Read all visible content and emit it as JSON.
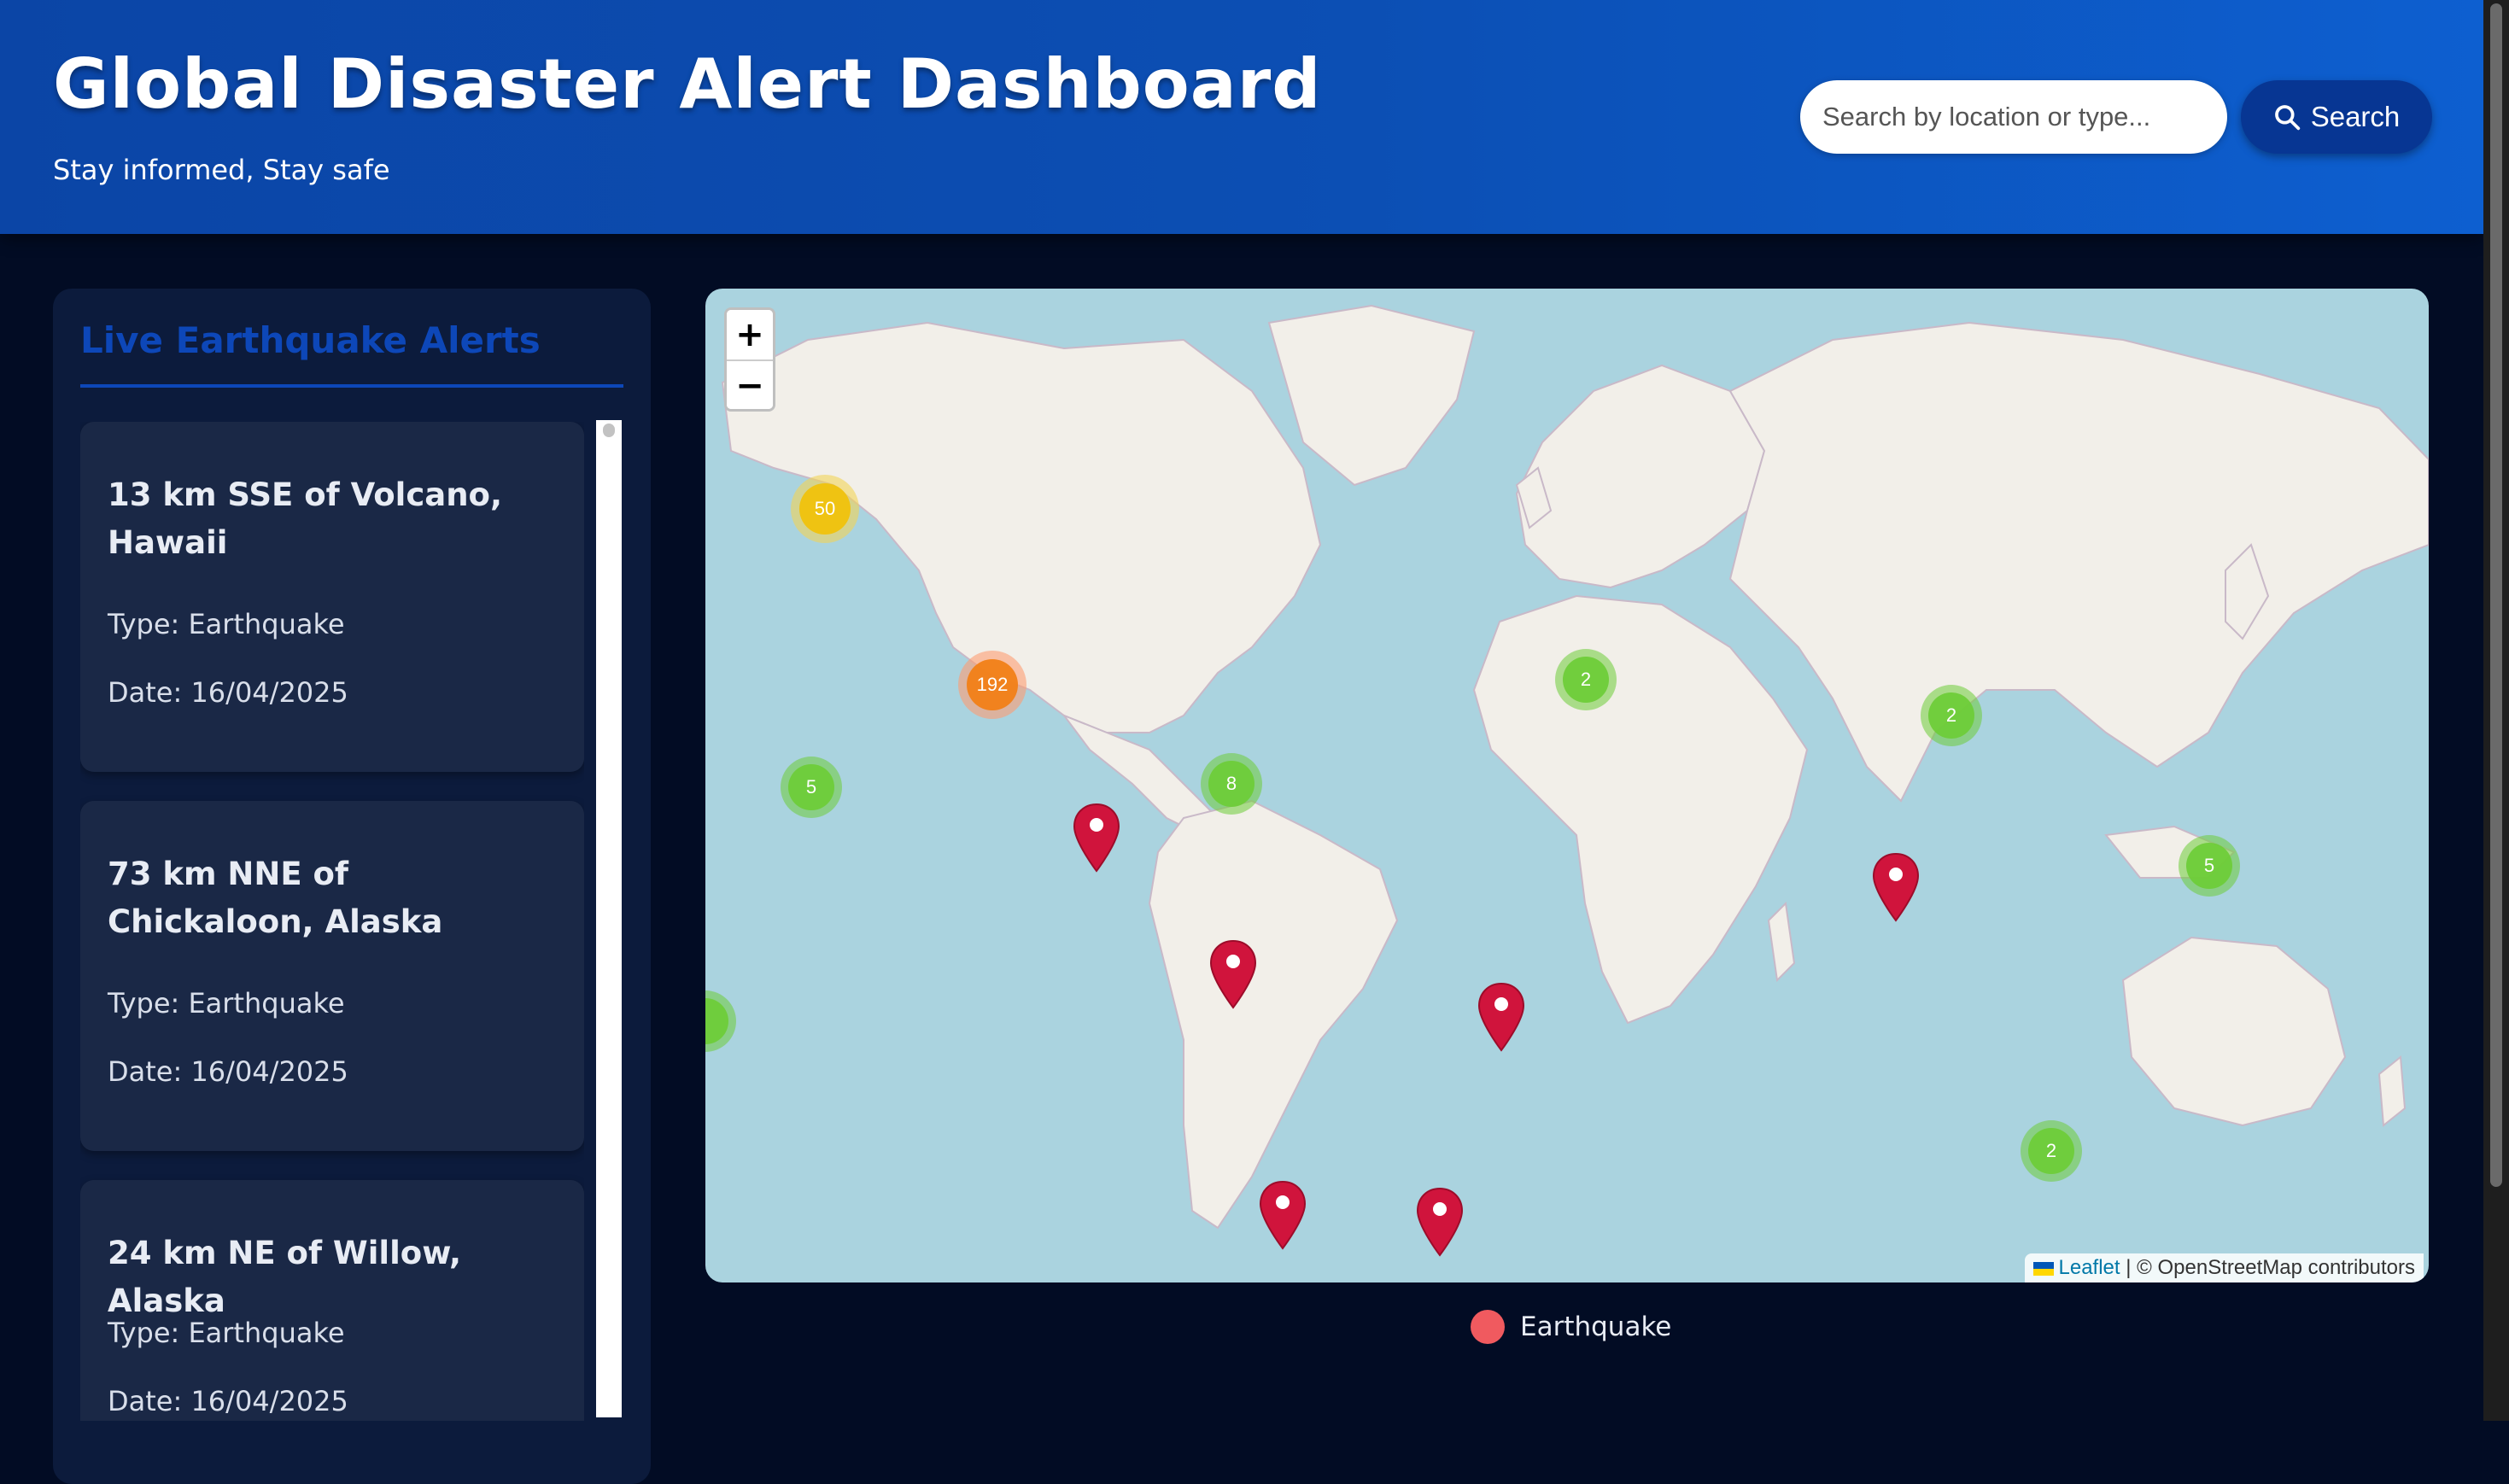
{
  "header": {
    "title": "Global Disaster Alert Dashboard",
    "subtitle": "Stay informed, Stay safe",
    "search_placeholder": "Search by location or type...",
    "search_button_label": "Search"
  },
  "sidebar": {
    "title": "Live Earthquake Alerts",
    "alerts": [
      {
        "title": "13 km SSE of Volcano, Hawaii",
        "type": "Type: Earthquake",
        "date": "Date: 16/04/2025"
      },
      {
        "title": "73 km NNE of Chickaloon, Alaska",
        "type": "Type: Earthquake",
        "date": "Date: 16/04/2025"
      },
      {
        "title": "24 km NE of Willow, Alaska",
        "type": "Type: Earthquake",
        "date": "Date: 16/04/2025"
      }
    ]
  },
  "map": {
    "zoom_in_label": "+",
    "zoom_out_label": "−",
    "clusters": [
      "50",
      "192",
      "5",
      "8",
      "2",
      "2",
      "5",
      "2"
    ],
    "attribution_link": "Leaflet",
    "attribution_text": "| © OpenStreetMap contributors"
  },
  "legend": {
    "label": "Earthquake",
    "color": "#f05a5f"
  },
  "colors": {
    "header": "#0c4fb4",
    "accent": "#0d47b8",
    "marker": "#d0143c"
  }
}
